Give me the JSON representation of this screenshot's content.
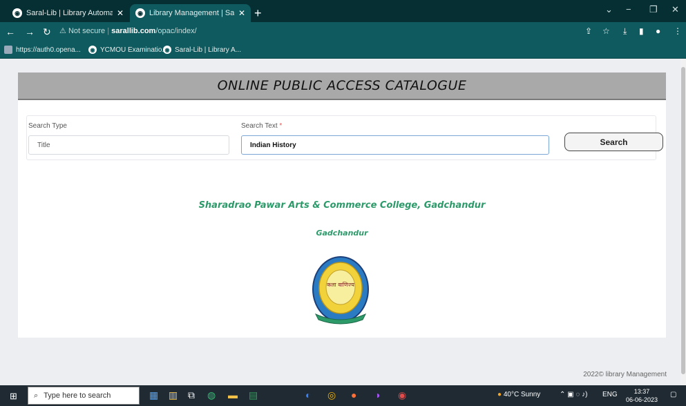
{
  "browser": {
    "tabs": [
      {
        "title": "Saral-Lib | Library Automation Sy",
        "close": "✕"
      },
      {
        "title": "Library Management | Saral Softw",
        "close": "✕"
      }
    ],
    "new_tab": "+",
    "window_controls": {
      "chevron": "⌄",
      "minimize": "−",
      "restore": "❐",
      "close": "✕"
    },
    "address": {
      "security": "Not secure",
      "domain": "sarallib.com",
      "path": "/opac/index/"
    },
    "bookmarks": [
      "https://auth0.opena...",
      "YCMOU Examinatio...",
      "Saral-Lib | Library A..."
    ]
  },
  "page": {
    "header_title": "ONLINE PUBLIC ACCESS CATALOGUE",
    "search": {
      "type_label": "Search Type",
      "type_value": "Title",
      "text_label": "Search Text",
      "required_mark": "*",
      "text_value": "Indian History",
      "button_label": "Search"
    },
    "college_name": "Sharadrao Pawar Arts & Commerce College, Gadchandur",
    "city": "Gadchandur",
    "emblem_text": "कला वाणिज्य",
    "footer": "2022© library Management"
  },
  "taskbar": {
    "search_placeholder": "Type here to search",
    "weather": "40°C  Sunny",
    "language": "ENG",
    "time": "13:37",
    "date": "06-06-2023"
  },
  "colors": {
    "accent": "#2d9a6a",
    "header_bg": "#a9a9a9",
    "chrome": "#0f5a5e"
  }
}
